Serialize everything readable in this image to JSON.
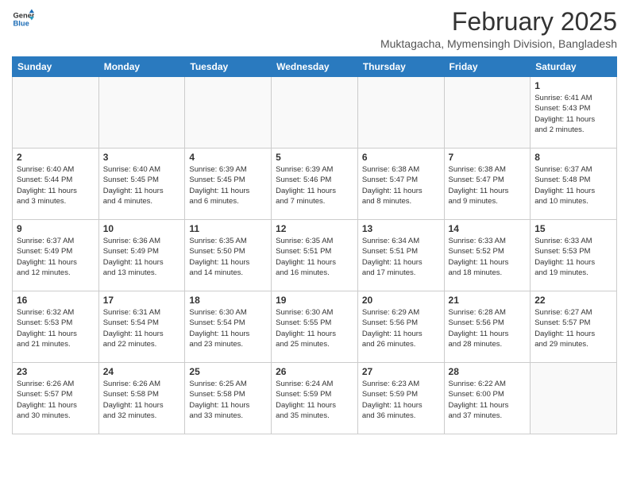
{
  "logo": {
    "line1": "General",
    "line2": "Blue"
  },
  "title": "February 2025",
  "subtitle": "Muktagacha, Mymensingh Division, Bangladesh",
  "weekdays": [
    "Sunday",
    "Monday",
    "Tuesday",
    "Wednesday",
    "Thursday",
    "Friday",
    "Saturday"
  ],
  "weeks": [
    [
      {
        "day": "",
        "info": ""
      },
      {
        "day": "",
        "info": ""
      },
      {
        "day": "",
        "info": ""
      },
      {
        "day": "",
        "info": ""
      },
      {
        "day": "",
        "info": ""
      },
      {
        "day": "",
        "info": ""
      },
      {
        "day": "1",
        "info": "Sunrise: 6:41 AM\nSunset: 5:43 PM\nDaylight: 11 hours\nand 2 minutes."
      }
    ],
    [
      {
        "day": "2",
        "info": "Sunrise: 6:40 AM\nSunset: 5:44 PM\nDaylight: 11 hours\nand 3 minutes."
      },
      {
        "day": "3",
        "info": "Sunrise: 6:40 AM\nSunset: 5:45 PM\nDaylight: 11 hours\nand 4 minutes."
      },
      {
        "day": "4",
        "info": "Sunrise: 6:39 AM\nSunset: 5:45 PM\nDaylight: 11 hours\nand 6 minutes."
      },
      {
        "day": "5",
        "info": "Sunrise: 6:39 AM\nSunset: 5:46 PM\nDaylight: 11 hours\nand 7 minutes."
      },
      {
        "day": "6",
        "info": "Sunrise: 6:38 AM\nSunset: 5:47 PM\nDaylight: 11 hours\nand 8 minutes."
      },
      {
        "day": "7",
        "info": "Sunrise: 6:38 AM\nSunset: 5:47 PM\nDaylight: 11 hours\nand 9 minutes."
      },
      {
        "day": "8",
        "info": "Sunrise: 6:37 AM\nSunset: 5:48 PM\nDaylight: 11 hours\nand 10 minutes."
      }
    ],
    [
      {
        "day": "9",
        "info": "Sunrise: 6:37 AM\nSunset: 5:49 PM\nDaylight: 11 hours\nand 12 minutes."
      },
      {
        "day": "10",
        "info": "Sunrise: 6:36 AM\nSunset: 5:49 PM\nDaylight: 11 hours\nand 13 minutes."
      },
      {
        "day": "11",
        "info": "Sunrise: 6:35 AM\nSunset: 5:50 PM\nDaylight: 11 hours\nand 14 minutes."
      },
      {
        "day": "12",
        "info": "Sunrise: 6:35 AM\nSunset: 5:51 PM\nDaylight: 11 hours\nand 16 minutes."
      },
      {
        "day": "13",
        "info": "Sunrise: 6:34 AM\nSunset: 5:51 PM\nDaylight: 11 hours\nand 17 minutes."
      },
      {
        "day": "14",
        "info": "Sunrise: 6:33 AM\nSunset: 5:52 PM\nDaylight: 11 hours\nand 18 minutes."
      },
      {
        "day": "15",
        "info": "Sunrise: 6:33 AM\nSunset: 5:53 PM\nDaylight: 11 hours\nand 19 minutes."
      }
    ],
    [
      {
        "day": "16",
        "info": "Sunrise: 6:32 AM\nSunset: 5:53 PM\nDaylight: 11 hours\nand 21 minutes."
      },
      {
        "day": "17",
        "info": "Sunrise: 6:31 AM\nSunset: 5:54 PM\nDaylight: 11 hours\nand 22 minutes."
      },
      {
        "day": "18",
        "info": "Sunrise: 6:30 AM\nSunset: 5:54 PM\nDaylight: 11 hours\nand 23 minutes."
      },
      {
        "day": "19",
        "info": "Sunrise: 6:30 AM\nSunset: 5:55 PM\nDaylight: 11 hours\nand 25 minutes."
      },
      {
        "day": "20",
        "info": "Sunrise: 6:29 AM\nSunset: 5:56 PM\nDaylight: 11 hours\nand 26 minutes."
      },
      {
        "day": "21",
        "info": "Sunrise: 6:28 AM\nSunset: 5:56 PM\nDaylight: 11 hours\nand 28 minutes."
      },
      {
        "day": "22",
        "info": "Sunrise: 6:27 AM\nSunset: 5:57 PM\nDaylight: 11 hours\nand 29 minutes."
      }
    ],
    [
      {
        "day": "23",
        "info": "Sunrise: 6:26 AM\nSunset: 5:57 PM\nDaylight: 11 hours\nand 30 minutes."
      },
      {
        "day": "24",
        "info": "Sunrise: 6:26 AM\nSunset: 5:58 PM\nDaylight: 11 hours\nand 32 minutes."
      },
      {
        "day": "25",
        "info": "Sunrise: 6:25 AM\nSunset: 5:58 PM\nDaylight: 11 hours\nand 33 minutes."
      },
      {
        "day": "26",
        "info": "Sunrise: 6:24 AM\nSunset: 5:59 PM\nDaylight: 11 hours\nand 35 minutes."
      },
      {
        "day": "27",
        "info": "Sunrise: 6:23 AM\nSunset: 5:59 PM\nDaylight: 11 hours\nand 36 minutes."
      },
      {
        "day": "28",
        "info": "Sunrise: 6:22 AM\nSunset: 6:00 PM\nDaylight: 11 hours\nand 37 minutes."
      },
      {
        "day": "",
        "info": ""
      }
    ]
  ]
}
